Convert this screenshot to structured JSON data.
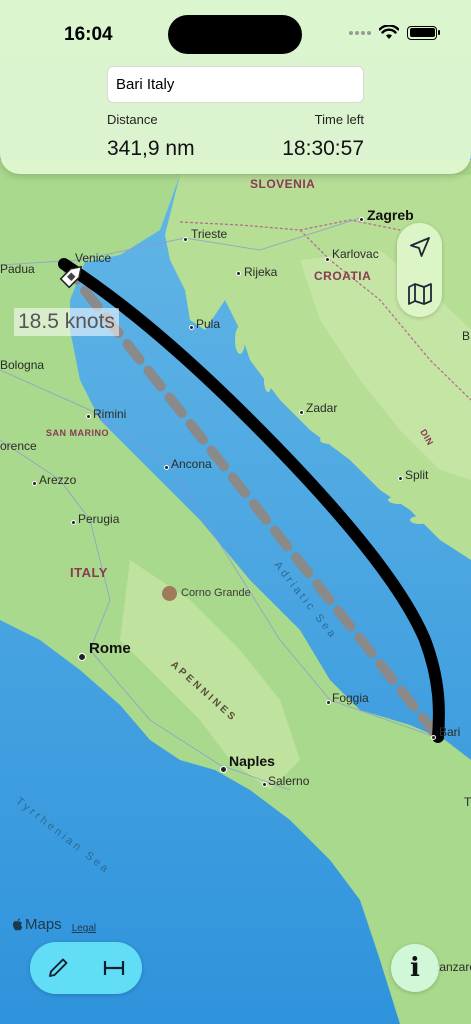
{
  "status_bar": {
    "time": "16:04"
  },
  "search": {
    "value": "Bari Italy"
  },
  "stats": {
    "distance_label": "Distance",
    "distance_value": "341,9 nm",
    "time_label": "Time left",
    "time_value": "18:30:57"
  },
  "route": {
    "speed_label": "18.5 knots"
  },
  "map_labels": {
    "slovenia": "SLOVENIA",
    "croatia": "CROATIA",
    "italy": "ITALY",
    "san_marino": "SAN MARINO",
    "zagreb": "Zagreb",
    "trieste": "Trieste",
    "venice": "Venice",
    "padua": "Padua",
    "karlovac": "Karlovac",
    "rijeka": "Rijeka",
    "pula": "Pula",
    "bologna": "Bologna",
    "rimini": "Rimini",
    "zadar": "Zadar",
    "florence": "orence",
    "split": "Split",
    "arezzo": "Arezzo",
    "ancona": "Ancona",
    "perugia": "Perugia",
    "adriatic_sea": "Adriatic Sea",
    "corno_grande": "Corno Grande",
    "rome": "Rome",
    "foggia": "Foggia",
    "bari": "Bari",
    "apennines": "APENNINES",
    "naples": "Naples",
    "salerno": "Salerno",
    "tyrrhenian_sea": "Tyrrhenian Sea",
    "catanzaro": "tanzaro",
    "edge_b": "B",
    "edge_din": "DIN",
    "edge_t": "T"
  },
  "footer": {
    "maps_label": "Maps",
    "legal_label": "Legal",
    "info_label": "i"
  },
  "icons": {
    "location": "location-arrow-icon",
    "map": "map-icon",
    "pencil": "pencil-icon",
    "measure": "measure-icon",
    "info": "info-icon"
  },
  "colors": {
    "panel_bg": "#e0f7ce",
    "toolbar_bg": "#64e1f5",
    "route_line": "#000000",
    "direct_line": "#8a8a8a",
    "sea": "#3d9ee0",
    "land": "#a8d98a"
  }
}
